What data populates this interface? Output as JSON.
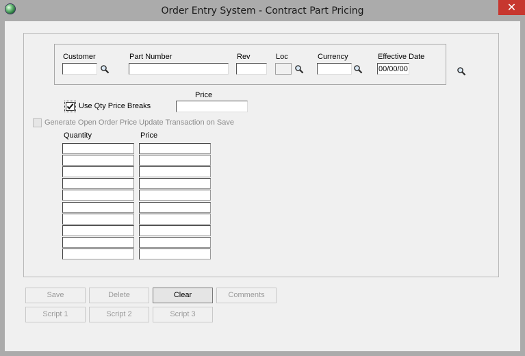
{
  "window": {
    "title": "Order Entry System - Contract Part Pricing",
    "close_glyph": "✕"
  },
  "header": {
    "customer_label": "Customer",
    "part_number_label": "Part Number",
    "rev_label": "Rev",
    "loc_label": "Loc",
    "currency_label": "Currency",
    "effective_date_label": "Effective Date",
    "customer_value": "",
    "part_number_value": "",
    "rev_value": "",
    "loc_value": "",
    "currency_value": "",
    "effective_date_value": "00/00/00"
  },
  "options": {
    "use_qty_price_breaks_label": "Use Qty Price Breaks",
    "use_qty_price_breaks_checked": true,
    "price_label": "Price",
    "price_value": "",
    "generate_update_label": "Generate Open Order Price Update Transaction on Save",
    "generate_update_checked": false
  },
  "breaks": {
    "quantity_header": "Quantity",
    "price_header": "Price",
    "rows": [
      {
        "quantity": "",
        "price": ""
      },
      {
        "quantity": "",
        "price": ""
      },
      {
        "quantity": "",
        "price": ""
      },
      {
        "quantity": "",
        "price": ""
      },
      {
        "quantity": "",
        "price": ""
      },
      {
        "quantity": "",
        "price": ""
      },
      {
        "quantity": "",
        "price": ""
      },
      {
        "quantity": "",
        "price": ""
      },
      {
        "quantity": "",
        "price": ""
      },
      {
        "quantity": "",
        "price": ""
      }
    ]
  },
  "buttons": {
    "save": "Save",
    "delete": "Delete",
    "clear": "Clear",
    "comments": "Comments",
    "script1": "Script 1",
    "script2": "Script 2",
    "script3": "Script 3"
  },
  "icons": {
    "lookup": "magnifier-icon",
    "app": "globe-icon",
    "close": "close-icon"
  }
}
